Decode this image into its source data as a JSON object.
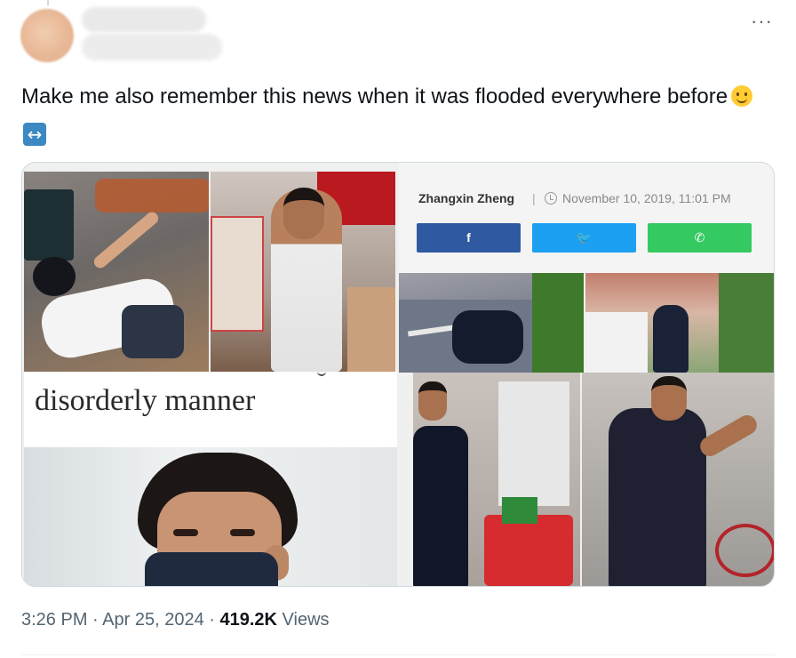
{
  "tweet": {
    "text": "Make me also remember this news when it was flooded everywhere before",
    "emojis": [
      "slightly-smiling-face",
      "left-right-arrow"
    ],
    "more_label": "···"
  },
  "media": {
    "caption_text": "disorderly manner",
    "article": {
      "author": "Zhangxin Zheng",
      "separator": "|",
      "date": "November 10, 2019, 11:01 PM",
      "share_buttons": [
        {
          "icon": "facebook-icon",
          "label": "f",
          "color": "#2f5aa1"
        },
        {
          "icon": "twitter-icon",
          "label": "🐦",
          "color": "#1ca0f2"
        },
        {
          "icon": "whatsapp-icon",
          "label": "✆",
          "color": "#35c961"
        }
      ]
    }
  },
  "meta": {
    "time": "3:26 PM",
    "dot1": " · ",
    "date": "Apr 25, 2024",
    "dot2": " · ",
    "views_count": "419.2K",
    "views_label": " Views"
  }
}
